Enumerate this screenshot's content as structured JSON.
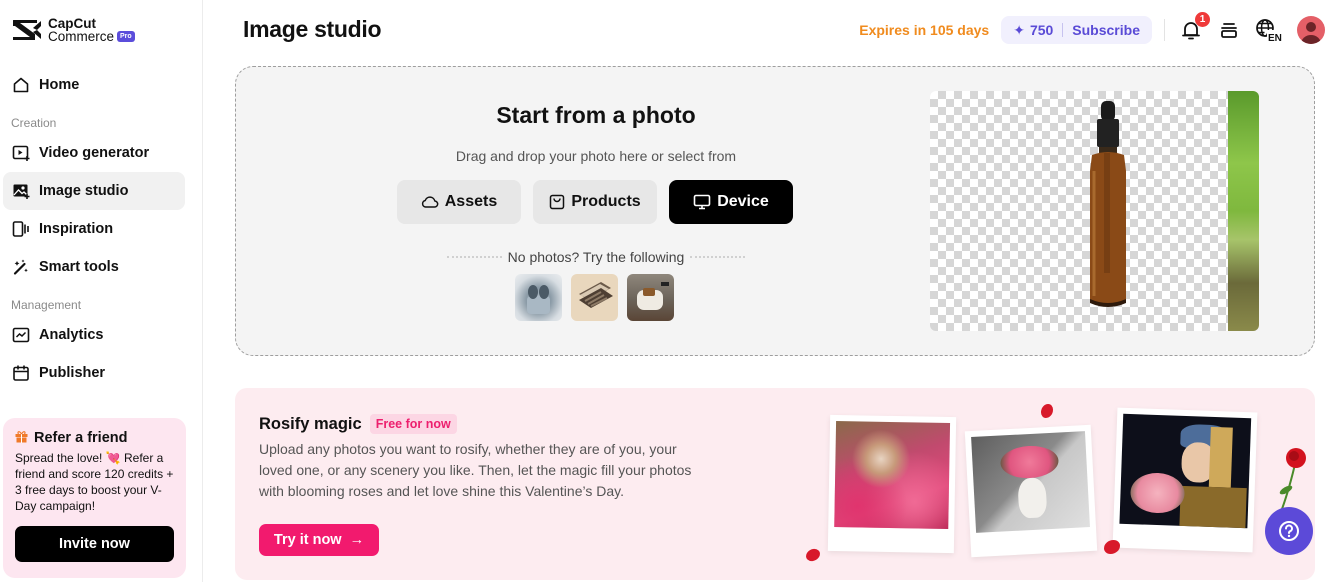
{
  "brand": {
    "line1": "CapCut",
    "line2": "Commerce",
    "badge": "Pro"
  },
  "sidebar": {
    "items": [
      {
        "label": "Home",
        "icon": "home-icon"
      },
      {
        "section": "Creation"
      },
      {
        "label": "Video generator",
        "icon": "video-generator-icon"
      },
      {
        "label": "Image studio",
        "icon": "image-studio-icon",
        "active": true
      },
      {
        "label": "Inspiration",
        "icon": "inspiration-icon"
      },
      {
        "label": "Smart tools",
        "icon": "magic-wand-icon"
      },
      {
        "section": "Management"
      },
      {
        "label": "Analytics",
        "icon": "analytics-icon"
      },
      {
        "label": "Publisher",
        "icon": "calendar-icon"
      }
    ],
    "home": "Home",
    "section_creation": "Creation",
    "video_generator": "Video generator",
    "image_studio": "Image studio",
    "inspiration": "Inspiration",
    "smart_tools": "Smart tools",
    "section_management": "Management",
    "analytics": "Analytics",
    "publisher": "Publisher"
  },
  "refer": {
    "title": "Refer a friend",
    "body": "Spread the love! 💘 Refer a friend and score 120 credits + 3 free days to boost your V-Day campaign!",
    "button": "Invite now"
  },
  "header": {
    "title": "Image studio",
    "expires": "Expires in 105 days",
    "credits": "750",
    "subscribe": "Subscribe",
    "notification_count": "1",
    "language": "EN"
  },
  "upload": {
    "title": "Start from a photo",
    "subtitle": "Drag and drop your photo here or select from",
    "buttons": {
      "assets": "Assets",
      "products": "Products",
      "device": "Device"
    },
    "try_label": "No photos? Try the following",
    "samples": [
      "earbuds-sample",
      "eyeshadow-palette-sample",
      "armchair-sample"
    ]
  },
  "rosify": {
    "title": "Rosify magic",
    "badge": "Free for now",
    "description": "Upload any photos you want to rosify, whether they are of you, your loved one, or any scenery you like. Then, let the magic fill your photos with blooming roses and let love shine this Valentine’s Day.",
    "cta": "Try it now",
    "cta_arrow": "→"
  },
  "colors": {
    "accent_purple": "#5c4ad8",
    "expires_orange": "#f08b1e",
    "rosify_pink": "#f21a6e",
    "badge_red": "#ef3a3a"
  }
}
